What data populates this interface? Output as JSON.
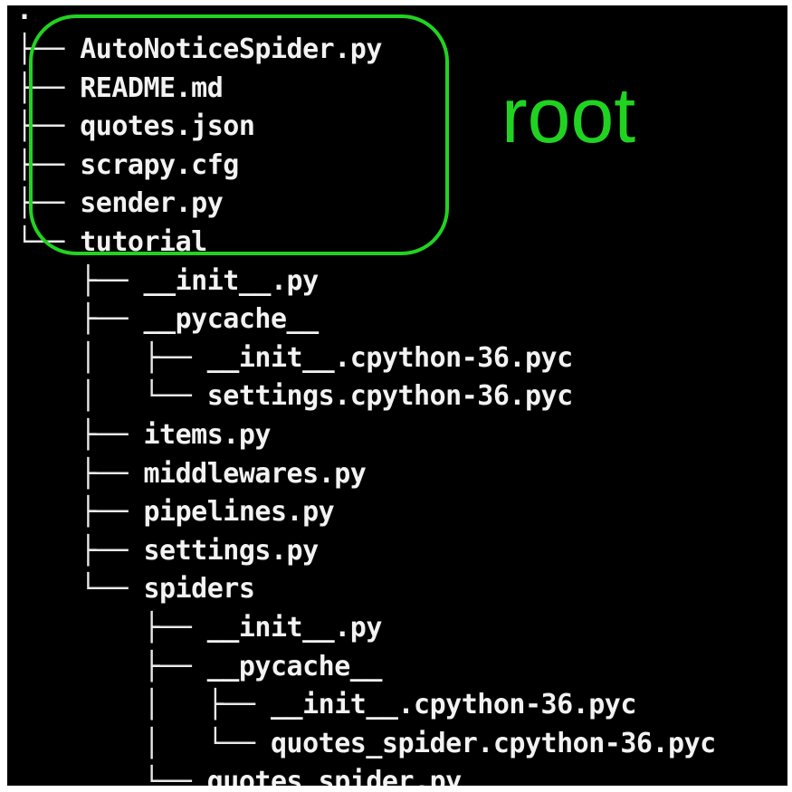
{
  "annotation": {
    "label": "root",
    "color": "#21d321"
  },
  "tree": {
    "root": ".",
    "lines": [
      {
        "prefix": "├── ",
        "name": "AutoNoticeSpider.py",
        "kind": "file"
      },
      {
        "prefix": "├── ",
        "name": "README.md",
        "kind": "file"
      },
      {
        "prefix": "├── ",
        "name": "quotes.json",
        "kind": "file"
      },
      {
        "prefix": "├── ",
        "name": "scrapy.cfg",
        "kind": "file"
      },
      {
        "prefix": "├── ",
        "name": "sender.py",
        "kind": "file"
      },
      {
        "prefix": "└── ",
        "name": "tutorial",
        "kind": "folder"
      },
      {
        "prefix": "    ├── ",
        "name": "__init__.py",
        "kind": "file"
      },
      {
        "prefix": "    ├── ",
        "name": "__pycache__",
        "kind": "folder"
      },
      {
        "prefix": "    │   ├── ",
        "name": "__init__.cpython-36.pyc",
        "kind": "file"
      },
      {
        "prefix": "    │   └── ",
        "name": "settings.cpython-36.pyc",
        "kind": "file"
      },
      {
        "prefix": "    ├── ",
        "name": "items.py",
        "kind": "file"
      },
      {
        "prefix": "    ├── ",
        "name": "middlewares.py",
        "kind": "file"
      },
      {
        "prefix": "    ├── ",
        "name": "pipelines.py",
        "kind": "file"
      },
      {
        "prefix": "    ├── ",
        "name": "settings.py",
        "kind": "file"
      },
      {
        "prefix": "    └── ",
        "name": "spiders",
        "kind": "folder"
      },
      {
        "prefix": "        ├── ",
        "name": "__init__.py",
        "kind": "file"
      },
      {
        "prefix": "        ├── ",
        "name": "__pycache__",
        "kind": "folder"
      },
      {
        "prefix": "        │   ├── ",
        "name": "__init__.cpython-36.pyc",
        "kind": "file"
      },
      {
        "prefix": "        │   └── ",
        "name": "quotes_spider.cpython-36.pyc",
        "kind": "file"
      },
      {
        "prefix": "        └── ",
        "name": "quotes_spider.py",
        "kind": "file"
      }
    ]
  }
}
